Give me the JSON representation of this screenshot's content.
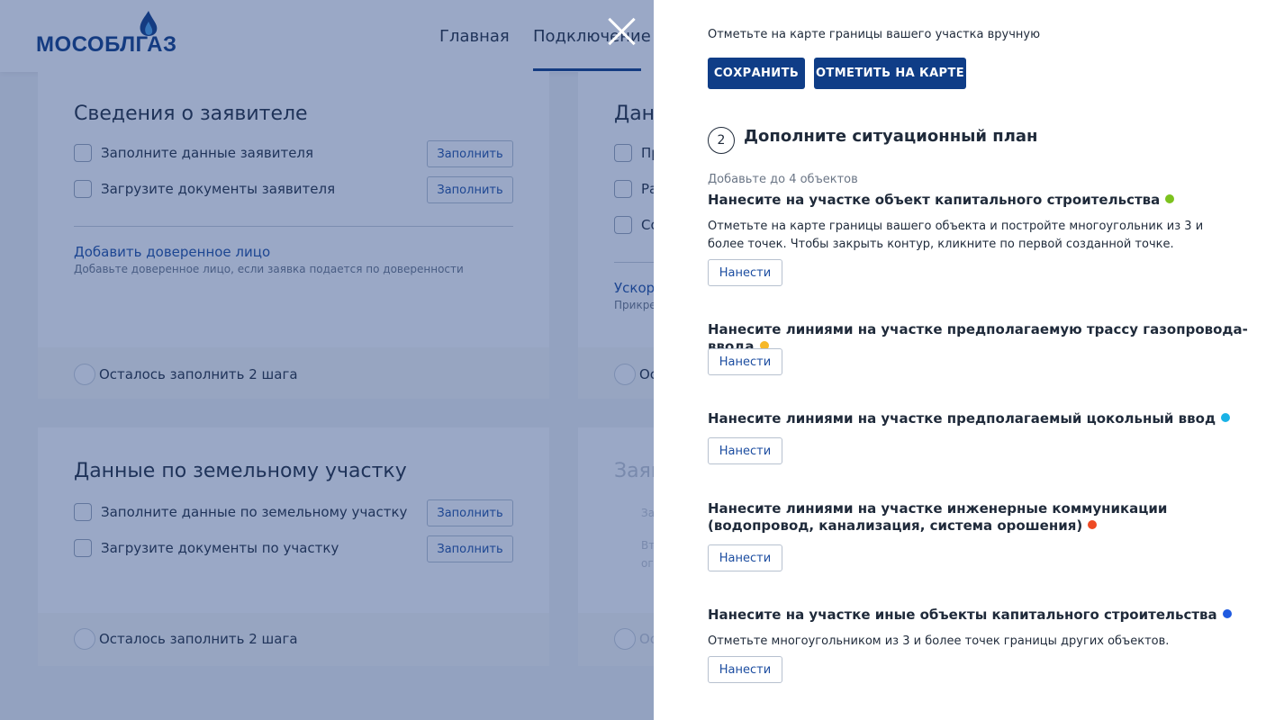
{
  "header": {
    "logo_text": "МОСОБЛГАЗ",
    "nav": [
      "Главная",
      "Подключение"
    ]
  },
  "cards": {
    "applicant": {
      "title": "Сведения о заявителе",
      "rows": [
        {
          "label": "Заполните данные заявителя",
          "button": "Заполнить"
        },
        {
          "label": "Загрузите документы заявителя",
          "button": "Заполнить"
        }
      ],
      "link": "Добавить доверенное лицо",
      "hint": "Добавьте доверенное лицо, если заявка подается по доверенности",
      "remaining": "Осталось заполнить 2 шага"
    },
    "right_top": {
      "title": "Дан",
      "rows": [
        "Пр",
        "Ра",
        "Со"
      ],
      "link": "Ускор",
      "hint": "Прикре",
      "remaining": "Ос"
    },
    "land": {
      "title": "Данные по земельному участку",
      "rows": [
        {
          "label": "Заполните данные по земельному участку",
          "button": "Заполнить"
        },
        {
          "label": "Загрузите документы по участку",
          "button": "Заполнить"
        }
      ],
      "remaining": "Осталось заполнить 2 шага"
    },
    "right_bottom": {
      "title": "Заяв",
      "line1": "За",
      "line2": "Вт",
      "line3": "ог",
      "remaining": "Ос"
    }
  },
  "panel": {
    "manual_hint": "Отметьте на карте границы вашего участка вручную",
    "save_button": "СОХРАНИТЬ",
    "mark_button": "ОТМЕТИТЬ НА КАРТЕ",
    "step_number": "2",
    "step_title": "Дополните ситуационный план",
    "step_subtitle": "Добавьте до 4 объектов",
    "objects": [
      {
        "title": "Нанесите на участке объект капитального строительства",
        "color": "#7cc21e",
        "desc": "Отметьте на карте границы вашего объекта и постройте многоугольник из 3 и более точек. Чтобы закрыть контур, кликните по первой созданной точке.",
        "button": "Нанести"
      },
      {
        "title": "Нанесите линиями на участке предполагаемую трассу газопровода-ввода",
        "color": "#f6b829",
        "desc": "",
        "button": "Нанести"
      },
      {
        "title": "Нанесите линиями на участке предполагаемый цокольный ввод",
        "color": "#1ab2e6",
        "desc": "",
        "button": "Нанести"
      },
      {
        "title": "Нанесите линиями на участке инженерные коммуникации (водопровод, канализация, система орошения)",
        "color": "#ee4a24",
        "desc": "",
        "button": "Нанести"
      },
      {
        "title": "Нанесите на участке иные объекты капитального строительства",
        "color": "#1f5ae0",
        "desc": "Отметьте многоугольником из 3 и более точек границы других объектов.",
        "button": "Нанести"
      }
    ]
  }
}
